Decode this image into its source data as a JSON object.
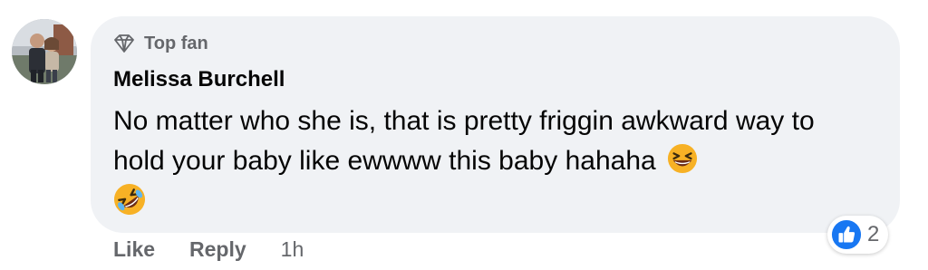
{
  "colors": {
    "bubble_bg": "#f0f2f5",
    "text_primary": "#050505",
    "text_secondary": "#65676b",
    "like_blue": "#1877f2",
    "emoji_yellow": "#f7b125"
  },
  "comment": {
    "badge": {
      "icon": "diamond-icon",
      "label": "Top fan"
    },
    "author": "Melissa Burchell",
    "text": "No matter who she is, that is pretty friggin awkward way to hold your baby like ewwww this baby hahaha",
    "emojis": [
      "laughing-emoji",
      "rolling-on-floor-laughing-emoji"
    ],
    "reactions": {
      "icon": "like-reaction-icon",
      "count": "2"
    },
    "actions": {
      "like": "Like",
      "reply": "Reply",
      "time": "1h"
    }
  }
}
